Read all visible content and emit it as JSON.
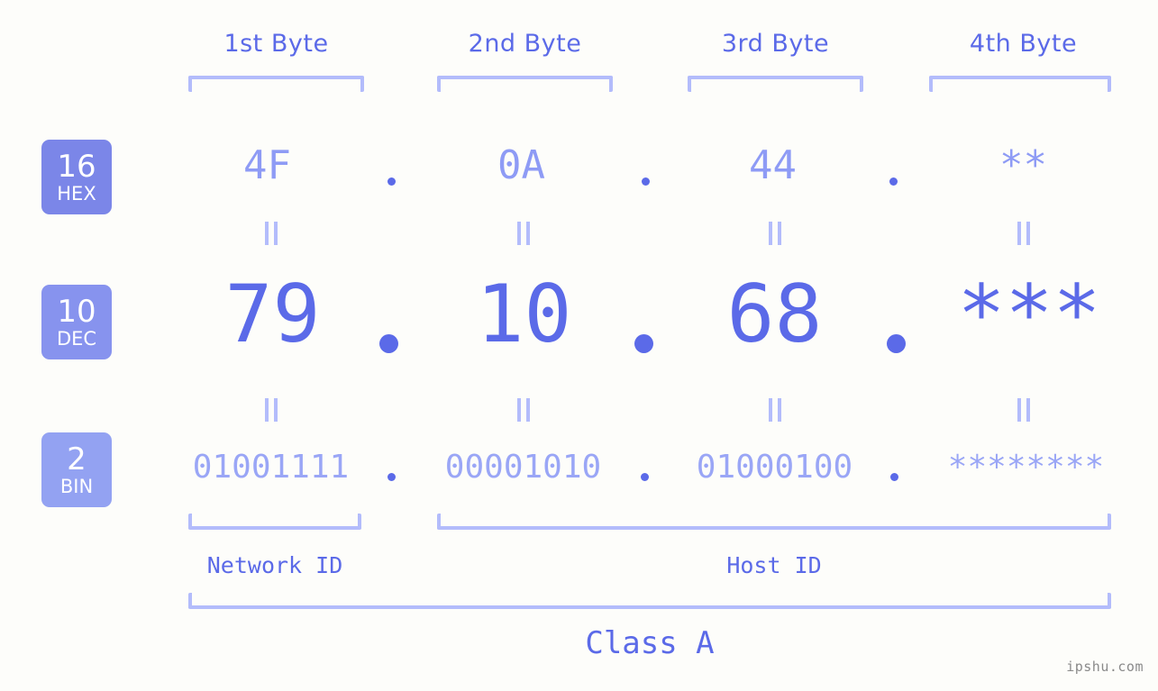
{
  "headers": [
    {
      "label": "1st Byte"
    },
    {
      "label": "2nd Byte"
    },
    {
      "label": "3rd Byte"
    },
    {
      "label": "4th Byte"
    }
  ],
  "radix_badges": [
    {
      "number": "16",
      "name": "HEX",
      "color": "#7b86e8"
    },
    {
      "number": "10",
      "name": "DEC",
      "color": "#8793ee"
    },
    {
      "number": "2",
      "name": "BIN",
      "color": "#93a2f2"
    }
  ],
  "rows": {
    "hex": {
      "radix": "16",
      "values": [
        "4F",
        "0A",
        "44",
        "**"
      ],
      "separator": "."
    },
    "dec": {
      "radix": "10",
      "values": [
        "79",
        "10",
        "68",
        "***"
      ],
      "separator": "."
    },
    "bin": {
      "radix": "2",
      "values": [
        "01001111",
        "00001010",
        "01000100",
        "********"
      ],
      "separator": "."
    }
  },
  "equality_marker": "||",
  "sections": [
    {
      "label": "Network ID"
    },
    {
      "label": "Host ID"
    }
  ],
  "class_label": "Class A",
  "watermark": "ipshu.com",
  "colors": {
    "background": "#fdfdfa",
    "accent": "#5b6ae8",
    "accent_light": "#b3bcfb",
    "hex_text": "#8e9bf5",
    "bin_text": "#9aa6f6",
    "watermark": "#8a8a8a"
  }
}
